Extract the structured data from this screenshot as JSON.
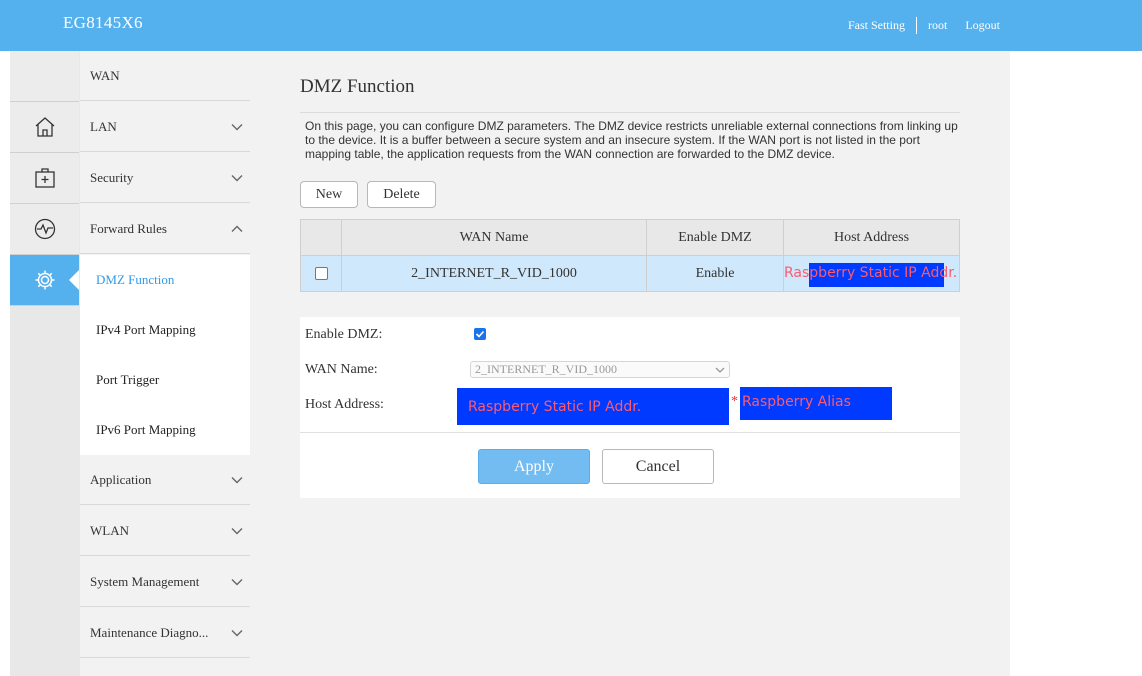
{
  "header": {
    "brand": "EG8145X6",
    "fast_setting": "Fast Setting",
    "user": "root",
    "logout": "Logout"
  },
  "rail": {
    "icons": [
      "home-icon",
      "medkit-icon",
      "pulse-icon",
      "gear-icon"
    ]
  },
  "menu": {
    "items": [
      {
        "label": "WAN"
      },
      {
        "label": "LAN"
      },
      {
        "label": "Security"
      },
      {
        "label": "Forward Rules"
      },
      {
        "label": "Application"
      },
      {
        "label": "WLAN"
      },
      {
        "label": "System Management"
      },
      {
        "label": "Maintenance Diagno..."
      }
    ],
    "sub_items": [
      {
        "label": "DMZ Function"
      },
      {
        "label": "IPv4 Port Mapping"
      },
      {
        "label": "Port Trigger"
      },
      {
        "label": "IPv6 Port Mapping"
      }
    ]
  },
  "main": {
    "title": "DMZ Function",
    "description": "On this page, you can configure DMZ parameters. The DMZ device restricts unreliable external connections from linking up to the device. It is a buffer between a secure system and an insecure system. If the WAN port is not listed in the port mapping table, the application requests from the WAN connection are forwarded to the DMZ device.",
    "new_button": "New",
    "delete_button": "Delete",
    "table": {
      "headers": [
        "WAN Name",
        "Enable DMZ",
        "Host Address"
      ],
      "rows": [
        {
          "wan_name": "2_INTERNET_R_VID_1000",
          "enable_dmz": "Enable",
          "host_address": "Raspberry Static IP Addr."
        }
      ]
    },
    "form": {
      "enable_label": "Enable DMZ:",
      "enable_checked": true,
      "wan_label": "WAN Name:",
      "wan_value": "2_INTERNET_R_VID_1000",
      "host_label": "Host Address:",
      "host_value": "Raspberry Static IP Addr.",
      "required_mark": "*",
      "host_alias": "Raspberry Alias",
      "apply": "Apply",
      "cancel": "Cancel"
    }
  },
  "colors": {
    "header": "#55b1ee",
    "accent": "#2e9be8",
    "selected_row": "#cfe8fb",
    "redaction": "#0039ff",
    "redaction_text": "#ff5a6e"
  }
}
